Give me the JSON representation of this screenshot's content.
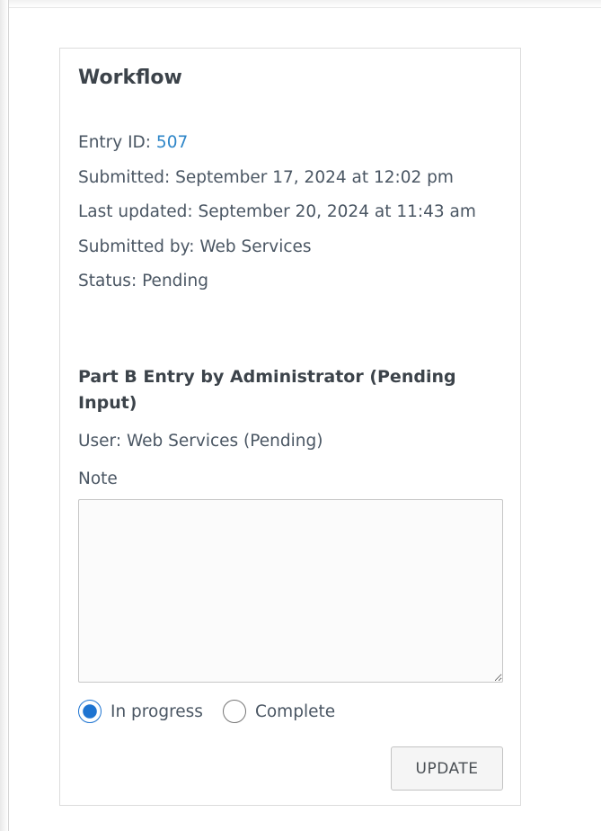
{
  "workflow": {
    "title": "Workflow",
    "entry_id_label": "Entry ID: ",
    "entry_id_value": "507",
    "submitted": "Submitted: September 17, 2024 at 12:02 pm",
    "last_updated": "Last updated: September 20, 2024 at 11:43 am",
    "submitted_by": "Submitted by: Web Services",
    "status": "Status: Pending"
  },
  "step": {
    "title": "Part B Entry by Administrator (Pending Input)",
    "user": "User: Web Services (Pending)",
    "note_label": "Note",
    "note_value": "",
    "options": [
      {
        "label": "In progress",
        "selected": true
      },
      {
        "label": "Complete",
        "selected": false
      }
    ],
    "update_label": "UPDATE"
  },
  "colors": {
    "link": "#2e86c8",
    "radio_selected": "#1e74d1",
    "text": "#4a5663",
    "heading": "#3c434a"
  }
}
